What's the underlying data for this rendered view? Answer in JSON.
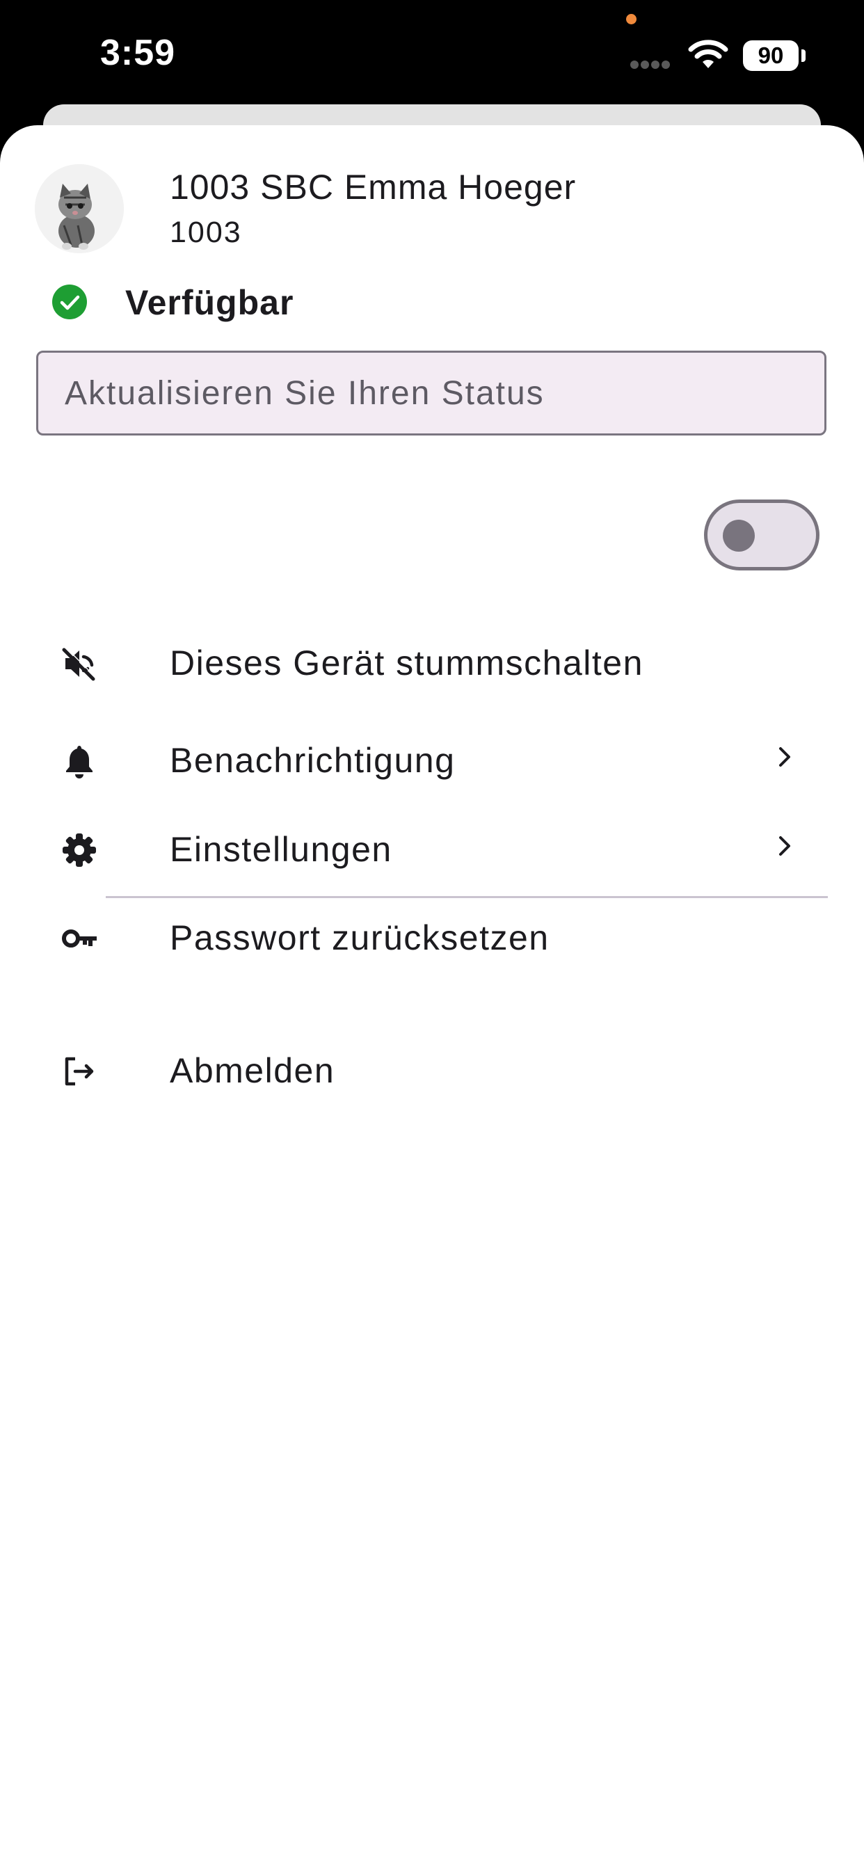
{
  "status_bar": {
    "time": "3:59",
    "battery": "90"
  },
  "profile": {
    "name": "1003 SBC Emma Hoeger",
    "extension": "1003",
    "avatar": "kitten-avatar"
  },
  "presence": {
    "label": "Verfügbar",
    "color": "#1e9e33"
  },
  "status_field": {
    "placeholder": "Aktualisieren Sie Ihren Status",
    "value": ""
  },
  "menu": {
    "mute": {
      "label": "Dieses Gerät stummschalten",
      "icon": "volume-off-icon",
      "toggle_on": false
    },
    "notifications": {
      "label": "Benachrichtigung",
      "icon": "bell-icon"
    },
    "settings": {
      "label": "Einstellungen",
      "icon": "gear-icon"
    },
    "password": {
      "label": "Passwort zurücksetzen",
      "icon": "key-icon"
    },
    "logout": {
      "label": "Abmelden",
      "icon": "logout-icon"
    }
  },
  "colors": {
    "field_background": "#f3ebf3",
    "toggle_outline": "#79747e",
    "divider": "#cac4d0"
  }
}
